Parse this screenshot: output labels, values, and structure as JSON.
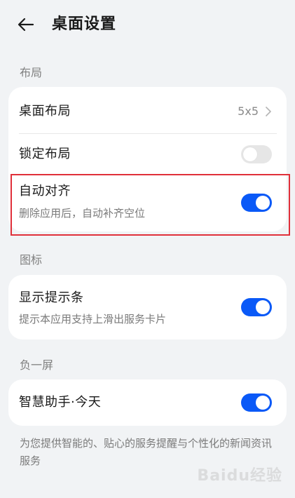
{
  "header": {
    "title": "桌面设置",
    "back_icon": "arrow-left-icon"
  },
  "sections": {
    "layout": {
      "label": "布局",
      "desktop_layout": {
        "title": "桌面布局",
        "value": "5x5"
      },
      "lock_layout": {
        "title": "锁定布局",
        "enabled": false
      },
      "auto_align": {
        "title": "自动对齐",
        "subtitle": "删除应用后，自动补齐空位",
        "enabled": true
      }
    },
    "icons": {
      "label": "图标",
      "show_hint_bar": {
        "title": "显示提示条",
        "subtitle": "提示本应用支持上滑出服务卡片",
        "enabled": true
      }
    },
    "minus_one_screen": {
      "label": "负一屏",
      "smart_assistant": {
        "title": "智慧助手·今天",
        "enabled": true
      },
      "footer": "为您提供智能的、贴心的服务提醒与个性化的新闻资讯服务"
    }
  },
  "colors": {
    "accent": "#0a59f7",
    "toggle_off": "#e6e6e6",
    "highlight": "#e0303a",
    "background": "#f1f3f5"
  },
  "watermark": "Baidu经验"
}
